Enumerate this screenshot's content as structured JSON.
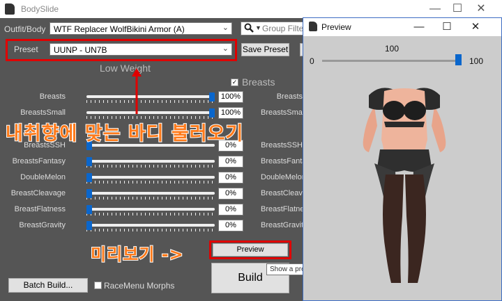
{
  "main_window": {
    "title": "BodySlide",
    "controls": {
      "minimize": "—",
      "maximize": "☐",
      "close": "✕"
    }
  },
  "outfit": {
    "label": "Outfit/Body",
    "value": "WTF Replacer WolfBikini Armor (A)"
  },
  "preset": {
    "label": "Preset",
    "value": "UUNP - UN7B",
    "save_label": "Save Preset"
  },
  "search": {
    "placeholder": "Group Filter"
  },
  "group_low": "Low Weight",
  "group_breasts": "Breasts",
  "sliders": [
    {
      "name": "Breasts",
      "value": "100%",
      "level": 1.0
    },
    {
      "name": "BreastsSmall",
      "value": "100%",
      "level": 1.0
    },
    {
      "name": "BreastsSH",
      "value": "0%",
      "level": 0.0
    },
    {
      "name": "BreastsSSH",
      "value": "0%",
      "level": 0.0
    },
    {
      "name": "BreastsFantasy",
      "value": "0%",
      "level": 0.0
    },
    {
      "name": "DoubleMelon",
      "value": "0%",
      "level": 0.0
    },
    {
      "name": "BreastCleavage",
      "value": "0%",
      "level": 0.0
    },
    {
      "name": "BreastFlatness",
      "value": "0%",
      "level": 0.0
    },
    {
      "name": "BreastGravity",
      "value": "0%",
      "level": 0.0
    }
  ],
  "sliders_right": [
    "Breasts",
    "BreastsSmall",
    "BreastsSSH",
    "BreastsFantasy",
    "DoubleMelon",
    "BreastCleavage",
    "BreastFlatness",
    "BreastGravity"
  ],
  "bottom": {
    "batch_build": "Batch Build...",
    "racemenu": "RaceMenu Morphs",
    "build": "Build",
    "preview": "Preview",
    "tooltip": "Show a preview window for this outfit."
  },
  "annotations": {
    "load_body": "내취향에 맞는 바디 불러오기",
    "preview": "미리보기 ->"
  },
  "preview_window": {
    "title": "Preview",
    "weight_value": "100",
    "min_label": "0",
    "max_label": "100",
    "weight_level": 1.0,
    "controls": {
      "minimize": "—",
      "maximize": "☐",
      "close": "✕"
    }
  },
  "colors": {
    "highlight": "#e00000",
    "annotation": "#ff7a1a",
    "slider_thumb": "#0a66cc"
  }
}
